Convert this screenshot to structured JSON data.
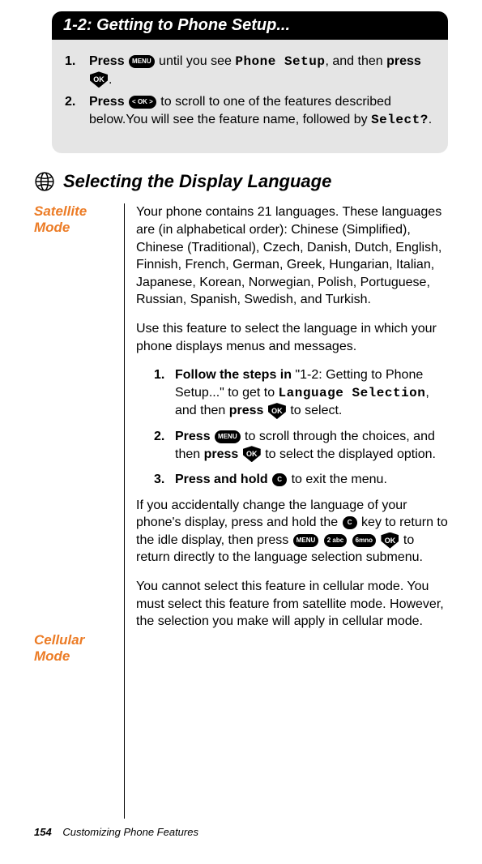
{
  "header": {
    "title": "1-2: Getting to Phone Setup..."
  },
  "steps": {
    "s1": {
      "num": "1.",
      "press1": "Press",
      "menu_icon": "MENU",
      "mid1": " until you see ",
      "lcd1": "Phone Setup",
      "mid2": ", and then ",
      "press2": "press",
      "ok_icon": "OK",
      "end": "."
    },
    "s2": {
      "num": "2.",
      "press1": "Press",
      "scroll_icon": "< OK >",
      "mid1": " to scroll to one of the features described below.You will see the feature name, followed by ",
      "lcd1": "Select?",
      "end": "."
    }
  },
  "section": {
    "title": "Selecting the Display Language"
  },
  "satellite": {
    "label": "Satellite Mode",
    "para1": "Your phone contains 21 languages. These languages are (in alphabetical order): Chinese (Simplified), Chinese (Traditional), Czech, Danish, Dutch, English, Finnish, French, German, Greek, Hungarian, Italian, Japanese, Korean, Norwegian, Polish, Portuguese, Russian, Spanish, Swedish, and Turkish.",
    "para2": "Use this feature to select the language in which your phone displays menus and messages.",
    "sub1": {
      "num": "1.",
      "b1": "Follow the steps in",
      "mid1": " \"1-2: Getting to Phone Setup...\" to get to ",
      "lcd1": "Language Selection",
      "mid2": ", and then ",
      "b2": "press",
      "ok": "OK",
      "end": " to select."
    },
    "sub2": {
      "num": "2.",
      "b1": "Press",
      "menu": "MENU",
      "mid1": " to scroll through the choices, and then ",
      "b2": "press",
      "ok": "OK",
      "end": " to select the displayed option."
    },
    "sub3": {
      "num": "3.",
      "b1": "Press and hold",
      "c": "C",
      "end": " to exit the menu."
    },
    "para3a": "If you accidentally change the language of your phone's display, press and hold the ",
    "c": "C",
    "para3b": " key to return to the idle display, then press ",
    "menu": "MENU",
    "two": "2 abc",
    "six": "6mno",
    "ok": "OK",
    "para3c": " to return directly to the language selection submenu."
  },
  "cellular": {
    "label": "Cellular Mode",
    "para1": "You cannot select this feature in cellular mode. You must select this feature from satellite mode. However, the selection you make will apply in cellular mode."
  },
  "footer": {
    "page": "154",
    "chapter": "Customizing Phone Features"
  }
}
